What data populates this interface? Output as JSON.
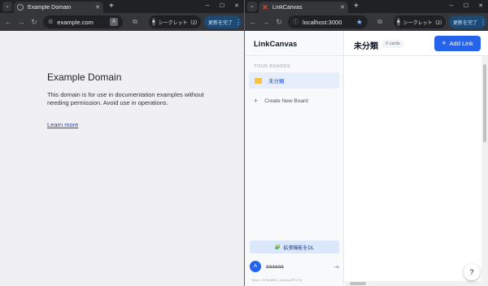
{
  "left_window": {
    "tab_title": "Example Domain",
    "url": "example.com",
    "incognito_label": "シークレット（2）",
    "update_label": "更新を完了",
    "page": {
      "heading": "Example Domain",
      "body": "This domain is for use in documentation examples without needing permission. Avoid use in operations.",
      "link": "Learn more"
    }
  },
  "right_window": {
    "tab_title": "LinkCanvas",
    "url": "localhost:3000",
    "incognito_label": "シークレット（2）",
    "update_label": "更新を完了",
    "app": {
      "brand": "LinkCanvas",
      "boards_label": "YOUR BOARDS",
      "boards": [
        {
          "label": "未分類"
        }
      ],
      "create_label": "Create New Board",
      "extension_label": "拡張機能をDL",
      "user": {
        "avatar": "A",
        "name": "aaaaaa"
      },
      "token_text": "Token: XOWrEBc1_tokenqJPFLYQ",
      "board_title": "未分類",
      "card_count": "0 cards",
      "add_link_label": "Add Link",
      "help_label": "?"
    }
  },
  "colors": {
    "accent": "#2563eb",
    "chrome_dark": "#202124",
    "chrome_toolbar": "#35363a"
  }
}
